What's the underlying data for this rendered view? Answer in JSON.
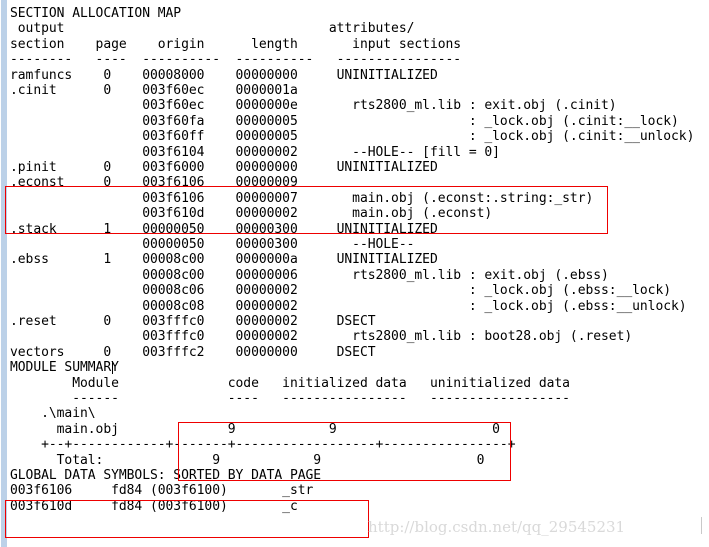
{
  "document": {
    "title": "SECTION ALLOCATION MAP",
    "watermark": "http://blog.csdn.net/qq_29545231",
    "caret_after": "MODULE SUMMARY"
  },
  "colors": {
    "annotation_red": "#ee0000",
    "margin_strip": "#bcd1e8",
    "text": "#000000",
    "watermark": "#d9d9d9",
    "background": "#ffffff"
  },
  "lines": [
    "SECTION ALLOCATION MAP",
    " output                                  attributes/",
    "section    page    origin      length       input sections",
    "--------   ----  ----------  ----------   ----------------",
    "ramfuncs    0    00008000    00000000     UNINITIALIZED",
    ".cinit      0    003f60ec    0000001a",
    "                 003f60ec    0000000e       rts2800_ml.lib : exit.obj (.cinit)",
    "                 003f60fa    00000005                      : _lock.obj (.cinit:__lock)",
    "                 003f60ff    00000005                      : _lock.obj (.cinit:__unlock)",
    "                 003f6104    00000002       --HOLE-- [fill = 0]",
    ".pinit      0    003f6000    00000000     UNINITIALIZED",
    ".econst     0    003f6106    00000009",
    "                 003f6106    00000007       main.obj (.econst:.string:_str)",
    "                 003f610d    00000002       main.obj (.econst)",
    ".stack      1    00000050    00000300     UNINITIALIZED",
    "                 00000050    00000300       --HOLE--",
    ".ebss       1    00008c00    0000000a     UNINITIALIZED",
    "                 00008c00    00000006       rts2800_ml.lib : exit.obj (.ebss)",
    "                 00008c06    00000002                      : _lock.obj (.ebss:__lock)",
    "                 00008c08    00000002                      : _lock.obj (.ebss:__unlock)",
    ".reset      0    003fffc0    00000002     DSECT",
    "                 003fffc0    00000002       rts2800_ml.lib : boot28.obj (.reset)",
    "vectors     0    003fffc2    00000000     DSECT",
    "MODULE SUMMARY",
    "        Module              code   initialized data   uninitialized data",
    "        ------              ----   ----------------   ------------------",
    "    .\\main\\",
    "      main.obj              9            9                    0",
    "    +--+------------+-------+------------------+----------------+",
    "      Total:              9            9                    0",
    "GLOBAL DATA SYMBOLS: SORTED BY DATA PAGE",
    "003f6106     fd84 (003f6100)       _str",
    "003f610d     fd84 (003f6100)       _c"
  ],
  "map_table": {
    "headers": {
      "output_section": "output\nsection",
      "page": "page",
      "origin": "origin",
      "length": "length",
      "attributes": "attributes/\n  input sections"
    },
    "rows": [
      {
        "section": "ramfuncs",
        "page": "0",
        "origin": "00008000",
        "length": "00000000",
        "attributes": "UNINITIALIZED"
      },
      {
        "section": ".cinit",
        "page": "0",
        "origin": "003f60ec",
        "length": "0000001a",
        "attributes": ""
      },
      {
        "section": "",
        "page": "",
        "origin": "003f60ec",
        "length": "0000000e",
        "attributes": "rts2800_ml.lib : exit.obj (.cinit)"
      },
      {
        "section": "",
        "page": "",
        "origin": "003f60fa",
        "length": "00000005",
        "attributes": ": _lock.obj (.cinit:__lock)"
      },
      {
        "section": "",
        "page": "",
        "origin": "003f60ff",
        "length": "00000005",
        "attributes": ": _lock.obj (.cinit:__unlock)"
      },
      {
        "section": "",
        "page": "",
        "origin": "003f6104",
        "length": "00000002",
        "attributes": "--HOLE-- [fill = 0]"
      },
      {
        "section": ".pinit",
        "page": "0",
        "origin": "003f6000",
        "length": "00000000",
        "attributes": "UNINITIALIZED"
      },
      {
        "section": ".econst",
        "page": "0",
        "origin": "003f6106",
        "length": "00000009",
        "attributes": ""
      },
      {
        "section": "",
        "page": "",
        "origin": "003f6106",
        "length": "00000007",
        "attributes": "main.obj (.econst:.string:_str)"
      },
      {
        "section": "",
        "page": "",
        "origin": "003f610d",
        "length": "00000002",
        "attributes": "main.obj (.econst)"
      },
      {
        "section": ".stack",
        "page": "1",
        "origin": "00000050",
        "length": "00000300",
        "attributes": "UNINITIALIZED"
      },
      {
        "section": "",
        "page": "",
        "origin": "00000050",
        "length": "00000300",
        "attributes": "--HOLE--"
      },
      {
        "section": ".ebss",
        "page": "1",
        "origin": "00008c00",
        "length": "0000000a",
        "attributes": "UNINITIALIZED"
      },
      {
        "section": "",
        "page": "",
        "origin": "00008c00",
        "length": "00000006",
        "attributes": "rts2800_ml.lib : exit.obj (.ebss)"
      },
      {
        "section": "",
        "page": "",
        "origin": "00008c06",
        "length": "00000002",
        "attributes": ": _lock.obj (.ebss:__lock)"
      },
      {
        "section": "",
        "page": "",
        "origin": "00008c08",
        "length": "00000002",
        "attributes": ": _lock.obj (.ebss:__unlock)"
      },
      {
        "section": ".reset",
        "page": "0",
        "origin": "003fffc0",
        "length": "00000002",
        "attributes": "DSECT"
      },
      {
        "section": "",
        "page": "",
        "origin": "003fffc0",
        "length": "00000002",
        "attributes": "rts2800_ml.lib : boot28.obj (.reset)"
      },
      {
        "section": "vectors",
        "page": "0",
        "origin": "003fffc2",
        "length": "00000000",
        "attributes": "DSECT"
      }
    ]
  },
  "module_summary": {
    "title": "MODULE SUMMARY",
    "headers": [
      "Module",
      "code",
      "initialized data",
      "uninitialized data"
    ],
    "folder": ".\\main\\",
    "rows": [
      {
        "module": "main.obj",
        "code": "9",
        "initialized_data": "9",
        "uninitialized_data": "0"
      }
    ],
    "total": {
      "label": "Total:",
      "code": "9",
      "initialized_data": "9",
      "uninitialized_data": "0"
    }
  },
  "global_data_symbols": {
    "title": "GLOBAL DATA SYMBOLS: SORTED BY DATA PAGE",
    "rows": [
      {
        "address": "003f6106",
        "page": "fd84",
        "page_base": "(003f6100)",
        "name": "_str"
      },
      {
        "address": "003f610d",
        "page": "fd84",
        "page_base": "(003f6100)",
        "name": "_c"
      }
    ]
  },
  "annotations": [
    {
      "id": "econst-highlight",
      "label": ".econst section highlight"
    },
    {
      "id": "module-summary-highlight",
      "label": "module summary counts highlight"
    },
    {
      "id": "global-symbols-highlight",
      "label": "global data symbols highlight"
    }
  ]
}
